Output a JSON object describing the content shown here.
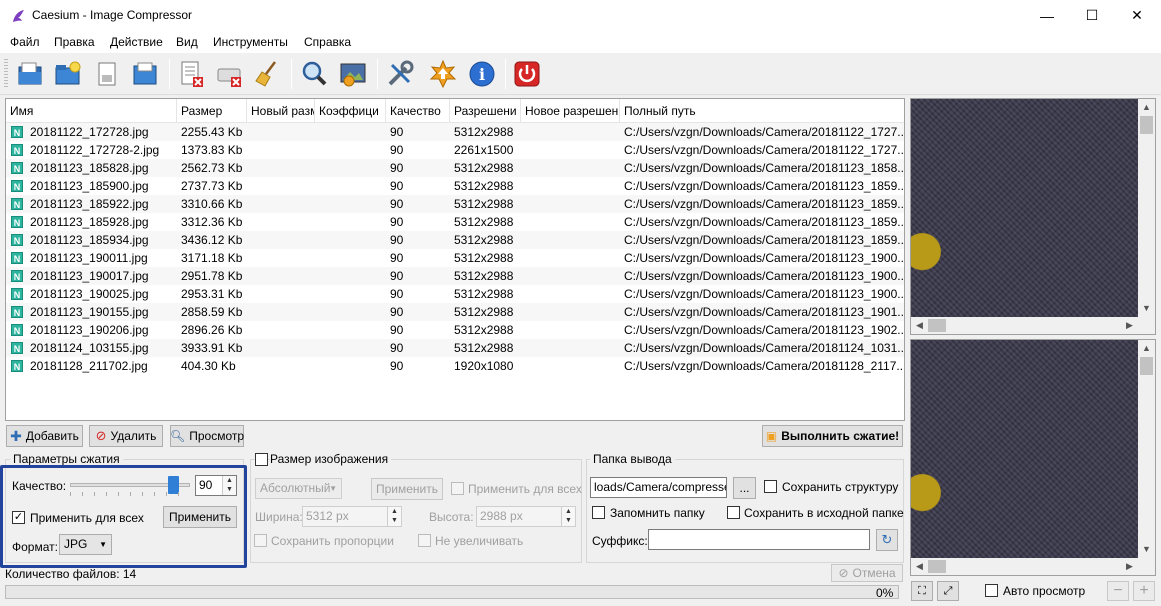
{
  "window": {
    "title": "Caesium - Image Compressor",
    "minimize": "—",
    "maximize": "☐",
    "close": "✕"
  },
  "menu": [
    "Файл",
    "Правка",
    "Действие",
    "Вид",
    "Инструменты",
    "Справка"
  ],
  "toolbar": {
    "icons": [
      "open-file-icon",
      "open-folder-icon",
      "save-icon",
      "save-as-icon",
      "remove-item-icon",
      "clear-list-icon",
      "clean-broom-icon",
      "search-icon",
      "preview-settings-icon",
      "tools-icon",
      "update-icon",
      "info-icon",
      "power-exit-icon"
    ]
  },
  "table": {
    "columns": [
      "Имя",
      "Размер",
      "Новый разм",
      "Коэффици",
      "Качество",
      "Разрешени",
      "Новое разрешен",
      "Полный путь"
    ],
    "rows": [
      [
        "20181122_172728.jpg",
        "2255.43 Kb",
        "",
        "",
        "90",
        "5312x2988",
        "",
        "C:/Users/vzgn/Downloads/Camera/20181122_1727..."
      ],
      [
        "20181122_172728-2.jpg",
        "1373.83 Kb",
        "",
        "",
        "90",
        "2261x1500",
        "",
        "C:/Users/vzgn/Downloads/Camera/20181122_1727..."
      ],
      [
        "20181123_185828.jpg",
        "2562.73 Kb",
        "",
        "",
        "90",
        "5312x2988",
        "",
        "C:/Users/vzgn/Downloads/Camera/20181123_1858..."
      ],
      [
        "20181123_185900.jpg",
        "2737.73 Kb",
        "",
        "",
        "90",
        "5312x2988",
        "",
        "C:/Users/vzgn/Downloads/Camera/20181123_1859..."
      ],
      [
        "20181123_185922.jpg",
        "3310.66 Kb",
        "",
        "",
        "90",
        "5312x2988",
        "",
        "C:/Users/vzgn/Downloads/Camera/20181123_1859..."
      ],
      [
        "20181123_185928.jpg",
        "3312.36 Kb",
        "",
        "",
        "90",
        "5312x2988",
        "",
        "C:/Users/vzgn/Downloads/Camera/20181123_1859..."
      ],
      [
        "20181123_185934.jpg",
        "3436.12 Kb",
        "",
        "",
        "90",
        "5312x2988",
        "",
        "C:/Users/vzgn/Downloads/Camera/20181123_1859..."
      ],
      [
        "20181123_190011.jpg",
        "3171.18 Kb",
        "",
        "",
        "90",
        "5312x2988",
        "",
        "C:/Users/vzgn/Downloads/Camera/20181123_1900..."
      ],
      [
        "20181123_190017.jpg",
        "2951.78 Kb",
        "",
        "",
        "90",
        "5312x2988",
        "",
        "C:/Users/vzgn/Downloads/Camera/20181123_1900..."
      ],
      [
        "20181123_190025.jpg",
        "2953.31 Kb",
        "",
        "",
        "90",
        "5312x2988",
        "",
        "C:/Users/vzgn/Downloads/Camera/20181123_1900..."
      ],
      [
        "20181123_190155.jpg",
        "2858.59 Kb",
        "",
        "",
        "90",
        "5312x2988",
        "",
        "C:/Users/vzgn/Downloads/Camera/20181123_1901..."
      ],
      [
        "20181123_190206.jpg",
        "2896.26 Kb",
        "",
        "",
        "90",
        "5312x2988",
        "",
        "C:/Users/vzgn/Downloads/Camera/20181123_1902..."
      ],
      [
        "20181124_103155.jpg",
        "3933.91 Kb",
        "",
        "",
        "90",
        "5312x2988",
        "",
        "C:/Users/vzgn/Downloads/Camera/20181124_1031..."
      ],
      [
        "20181128_211702.jpg",
        "404.30 Kb",
        "",
        "",
        "90",
        "1920x1080",
        "",
        "C:/Users/vzgn/Downloads/Camera/20181128_2117..."
      ]
    ]
  },
  "list_buttons": {
    "add": "Добавить",
    "remove": "Удалить",
    "preview": "Просмотр",
    "compress": "Выполнить сжатие!"
  },
  "compression": {
    "title": "Параметры сжатия",
    "quality_label": "Качество:",
    "quality_value": "90",
    "quality_fraction": 0.9,
    "apply_all_label": "Применить для всех",
    "apply_all_checked": true,
    "apply_button": "Применить",
    "format_label": "Формат:",
    "format_value": "JPG"
  },
  "resize": {
    "title": "Размер изображения",
    "mode": "Абсолютный",
    "apply_button": "Применить",
    "apply_all_label": "Применить для всех",
    "width_label": "Ширина:",
    "width_value": "5312 px",
    "height_label": "Высота:",
    "height_value": "2988 px",
    "keep_ratio_label": "Сохранить пропорции",
    "no_enlarge_label": "Не увеличивать"
  },
  "output": {
    "title": "Папка вывода",
    "path": "loads/Camera/compressed",
    "browse": "...",
    "keep_structure_label": "Сохранить структуру",
    "remember_folder_label": "Запомнить папку",
    "save_in_source_label": "Сохранить в исходной папке",
    "suffix_label": "Суффикс:",
    "suffix_value": ""
  },
  "status": {
    "file_count": "Количество файлов: 14",
    "cancel": "Отмена",
    "progress_text": "0%",
    "progress_fraction": 0
  },
  "preview_panel": {
    "auto_preview_label": "Авто просмотр",
    "zoom_out": "−",
    "zoom_in": "+"
  },
  "colors": {
    "highlight": "#22449c",
    "row_icon": "#2db5a0"
  }
}
